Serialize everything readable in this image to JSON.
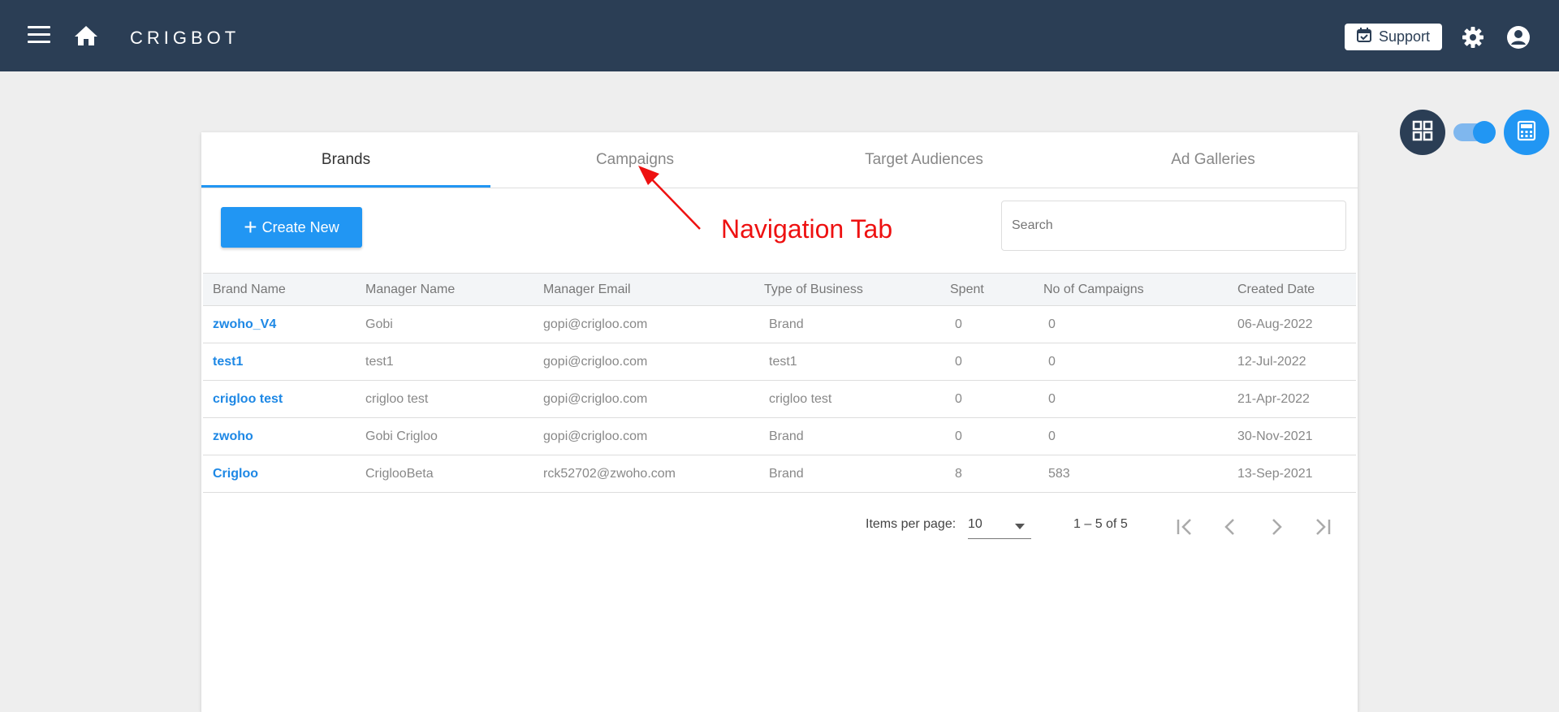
{
  "header": {
    "brand": "CRIGBOT",
    "support_label": "Support",
    "icons": [
      "menu-icon",
      "home-icon",
      "calendar-check-icon",
      "gear-icon",
      "account-circle-icon"
    ]
  },
  "floating": {
    "grid_icon": "grid-view-icon",
    "calc_icon": "calculator-icon",
    "toggle_on": true
  },
  "tabs": [
    {
      "label": "Brands",
      "active": true
    },
    {
      "label": "Campaigns",
      "active": false
    },
    {
      "label": "Target Audiences",
      "active": false
    },
    {
      "label": "Ad Galleries",
      "active": false
    }
  ],
  "toolbar": {
    "create_label": "Create New",
    "search_placeholder": "Search"
  },
  "table": {
    "columns": [
      "Brand Name",
      "Manager Name",
      "Manager Email",
      "Type of Business",
      "Spent",
      "No of Campaigns",
      "Created Date"
    ],
    "rows": [
      [
        "zwoho_V4",
        "Gobi",
        "gopi@crigloo.com",
        "Brand",
        "0",
        "0",
        "06-Aug-2022"
      ],
      [
        "test1",
        "test1",
        "gopi@crigloo.com",
        "test1",
        "0",
        "0",
        "12-Jul-2022"
      ],
      [
        "crigloo test",
        "crigloo test",
        "gopi@crigloo.com",
        "crigloo test",
        "0",
        "0",
        "21-Apr-2022"
      ],
      [
        "zwoho",
        "Gobi Crigloo",
        "gopi@crigloo.com",
        "Brand",
        "0",
        "0",
        "30-Nov-2021"
      ],
      [
        "Crigloo",
        "CriglooBeta",
        "rck52702@zwoho.com",
        "Brand",
        "8",
        "583",
        "13-Sep-2021"
      ]
    ]
  },
  "pager": {
    "items_per_page_label": "Items per page:",
    "items_per_page_value": "10",
    "range_label": "1 – 5 of 5"
  },
  "annotation": {
    "label": "Navigation Tab",
    "color": "#ee1111"
  },
  "colors": {
    "topbar": "#2b3e55",
    "accent": "#2196f3",
    "link": "#1e88e5"
  }
}
